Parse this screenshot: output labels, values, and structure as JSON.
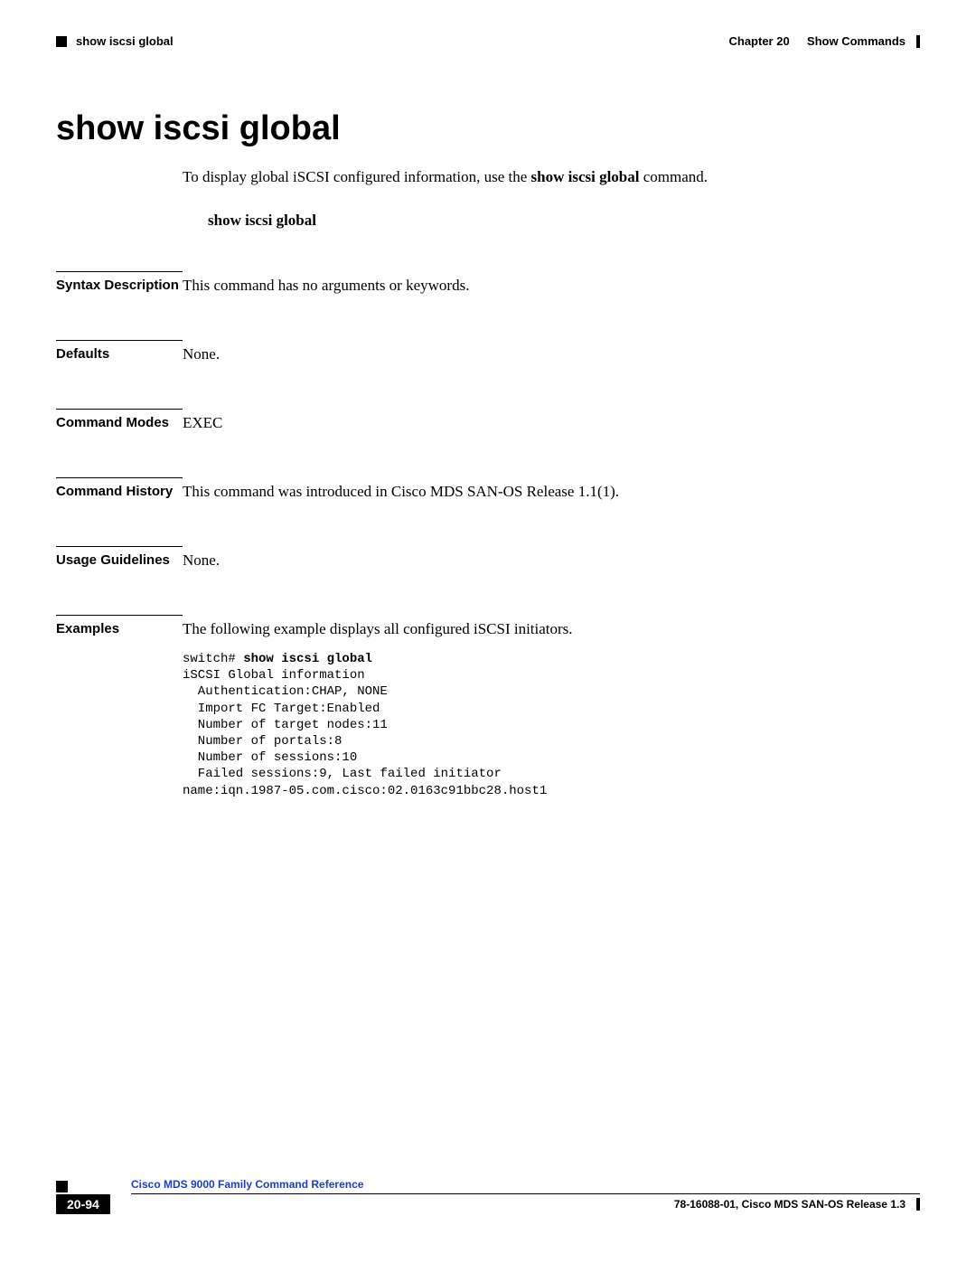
{
  "header": {
    "section_name": "show iscsi global",
    "chapter_label": "Chapter 20",
    "chapter_title": "Show Commands"
  },
  "title": "show iscsi global",
  "intro": {
    "prefix": "To display global iSCSI configured information, use the ",
    "bold_cmd": "show iscsi global",
    "suffix": " command."
  },
  "syntax_display": "show iscsi global",
  "sections": {
    "syntax_description": {
      "label": "Syntax Description",
      "content": "This command has no arguments or keywords."
    },
    "defaults": {
      "label": "Defaults",
      "content": "None."
    },
    "command_modes": {
      "label": "Command Modes",
      "content": "EXEC"
    },
    "command_history": {
      "label": "Command History",
      "content": "This command was introduced in Cisco MDS SAN-OS Release 1.1(1)."
    },
    "usage_guidelines": {
      "label": "Usage Guidelines",
      "content": "None."
    },
    "examples": {
      "label": "Examples",
      "intro": "The following example displays all configured iSCSI initiators.",
      "code_prompt": "switch# ",
      "code_command": "show iscsi global",
      "code_output": "iSCSI Global information\n  Authentication:CHAP, NONE\n  Import FC Target:Enabled\n  Number of target nodes:11\n  Number of portals:8\n  Number of sessions:10\n  Failed sessions:9, Last failed initiator\nname:iqn.1987-05.com.cisco:02.0163c91bbc28.host1"
    }
  },
  "footer": {
    "book_title": "Cisco MDS 9000 Family Command Reference",
    "page_number": "20-94",
    "release_info": "78-16088-01, Cisco MDS SAN-OS Release 1.3"
  }
}
